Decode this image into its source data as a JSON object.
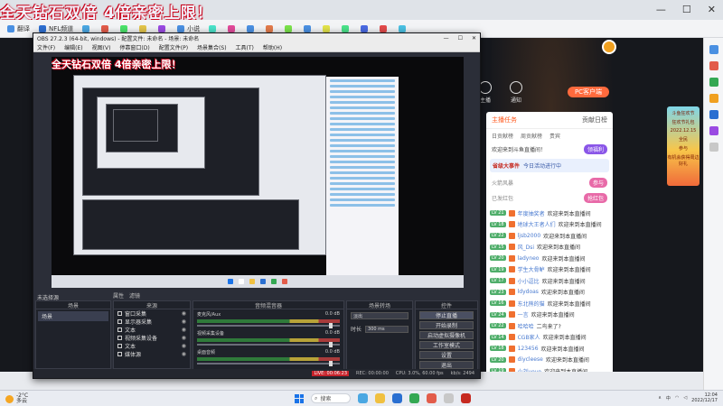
{
  "browser": {
    "promo_text": "全天钻石双倍 4倍亲密上限！",
    "bookmarks": [
      {
        "label": "翻译",
        "color": "#4a90e2"
      },
      {
        "label": "NFL频道",
        "color": "#2e6fd1"
      },
      {
        "label": "",
        "color": "#4aa7e2"
      },
      {
        "label": "",
        "color": "#e25c4a"
      },
      {
        "label": "",
        "color": "#4ae26a"
      },
      {
        "label": "",
        "color": "#e2c44a"
      },
      {
        "label": "",
        "color": "#9a4ae2"
      },
      {
        "label": "小说",
        "color": "#4a90e2"
      },
      {
        "label": "",
        "color": "#4ae2c9"
      },
      {
        "label": "",
        "color": "#e24a9a"
      },
      {
        "label": "",
        "color": "#4a90e2"
      },
      {
        "label": "",
        "color": "#e27a4a"
      },
      {
        "label": "",
        "color": "#7ae24a"
      },
      {
        "label": "",
        "color": "#4a90e2"
      },
      {
        "label": "",
        "color": "#e2e24a"
      },
      {
        "label": "",
        "color": "#4ae28a"
      },
      {
        "label": "",
        "color": "#4a6ae2"
      },
      {
        "label": "",
        "color": "#e24a4a"
      },
      {
        "label": "",
        "color": "#4ac0e2"
      }
    ],
    "window_controls": [
      "—",
      "☐",
      "✕"
    ]
  },
  "obs": {
    "title": "OBS 27.2.3 (64-bit, windows) - 配置文件: 未命名 - 场景: 未命名",
    "menu": [
      "文件(F)",
      "编辑(E)",
      "视图(V)",
      "停靠窗口(D)",
      "配置文件(P)",
      "场景集合(S)",
      "工具(T)",
      "帮助(H)"
    ],
    "window_controls": [
      "—",
      "☐",
      "✕"
    ],
    "dock_row_label": "未选择源",
    "dock_row_tabs": [
      "属性",
      "滤镜"
    ],
    "scenes": {
      "title": "场景",
      "items": [
        "场景"
      ]
    },
    "sources": {
      "title": "来源",
      "items": [
        "窗口采集",
        "显示器采集",
        "文本",
        "视频采集设备",
        "文本",
        "媒体源"
      ]
    },
    "mixer": {
      "title": "音频混音器",
      "tracks": [
        {
          "name": "麦克风/Aux",
          "db": "0.0 dB"
        },
        {
          "name": "视频采集设备",
          "db": "0.0 dB"
        },
        {
          "name": "桌面音频",
          "db": "0.0 dB"
        }
      ]
    },
    "transitions": {
      "title": "场景转场",
      "type": "淡出",
      "duration_label": "时长",
      "duration": "300 ms"
    },
    "controls": {
      "title": "控件",
      "buttons": [
        "停止直播",
        "开始录制",
        "启动虚拟摄像机",
        "工作室模式",
        "设置",
        "退出"
      ]
    },
    "status": {
      "live": "LIVE: 00:06:23",
      "rec": "REC: 00:00:00",
      "cpu": "CPU: 3.0%, 60.00 fps",
      "kbps": "kb/s: 2494"
    },
    "preview_title": "全天钻石双倍 4倍亲密上限！"
  },
  "live_page": {
    "top_icons": [
      "主播",
      "通知"
    ],
    "pc_button": "PC客户端",
    "chat": {
      "tabs": [
        "主播任务",
        "贡献日榜"
      ],
      "subtabs": [
        "日贡献榜",
        "周贡献榜",
        "贵宾"
      ],
      "notice": "欢迎来到斗鱼直播间！",
      "notice_btn": "领福利",
      "event_title": "省级大事件",
      "event_text": "今日活动进行中",
      "gift_rows": [
        {
          "text": "火箭风暴",
          "btn": "参与"
        },
        {
          "text": "已发红包",
          "btn": "抢红包"
        }
      ],
      "messages": [
        {
          "level": "LV 21",
          "user": "年度抽奖者",
          "text": "欢迎来到本直播间"
        },
        {
          "level": "LV 18",
          "user": "地球大王者人们",
          "text": "欢迎来到本直播间"
        },
        {
          "level": "LV 22",
          "user": "ljsb2000",
          "text": "欢迎来到本直播间"
        },
        {
          "level": "LV 15",
          "user": "风_Dsi",
          "text": "欢迎来到本直播间"
        },
        {
          "level": "LV 20",
          "user": "ladyneo",
          "text": "欢迎来到本直播间"
        },
        {
          "level": "LV 19",
          "user": "学生大骨鲈",
          "text": "欢迎来到本直播间"
        },
        {
          "level": "LV 17",
          "user": "小小逗比",
          "text": "欢迎来到本直播间"
        },
        {
          "level": "LV 23",
          "user": "ldydoas",
          "text": "欢迎来到本直播间"
        },
        {
          "level": "LV 16",
          "user": "东北熊的猫",
          "text": "欢迎来到本直播间"
        },
        {
          "level": "LV 24",
          "user": "一言",
          "text": "欢迎来到本直播间"
        },
        {
          "level": "LV 22",
          "user": "哈哈哈",
          "text": "二鸟来了?"
        },
        {
          "level": "LV 14",
          "user": "CGB家人",
          "text": "欢迎来到本直播间"
        },
        {
          "level": "LV 18",
          "user": "123456",
          "text": "欢迎来到本直播间"
        },
        {
          "level": "LV 20",
          "user": "diycleese",
          "text": "欢迎来到本直播间"
        },
        {
          "level": "LV 19",
          "user": "小刘yoyo",
          "text": "欢迎来到本直播间"
        },
        {
          "level": "LV 21",
          "user": "hj5512908",
          "text": "欢迎来到本直播间"
        },
        {
          "level": "LV 15",
          "user": "blue下雨",
          "text": "欢迎来到本直播间"
        },
        {
          "level": "LV 17",
          "user": "四号饭友",
          "text": "欢迎来到本直播间"
        },
        {
          "level": "LV 22",
          "user": "dss下楼等sophey",
          "text": "欢迎来到本直播间"
        }
      ],
      "footer": "聊天"
    },
    "ad_banner": [
      "斗鱼狂欢节",
      "狂欢节礼包",
      "2022.12.15",
      "全民",
      "参与",
      "有机会获得周边好礼"
    ]
  },
  "taskbar": {
    "weather_temp": "-2°C",
    "weather_desc": "多云",
    "search_label": "搜索",
    "time": "12:04",
    "date": "2022/12/17",
    "tray_lang": "中",
    "app_colors": [
      "#4aa7e2",
      "#f0c040",
      "#2a6fd1",
      "#34a853",
      "#e25c4a",
      "#c8c8c8",
      "#c62a20"
    ]
  }
}
